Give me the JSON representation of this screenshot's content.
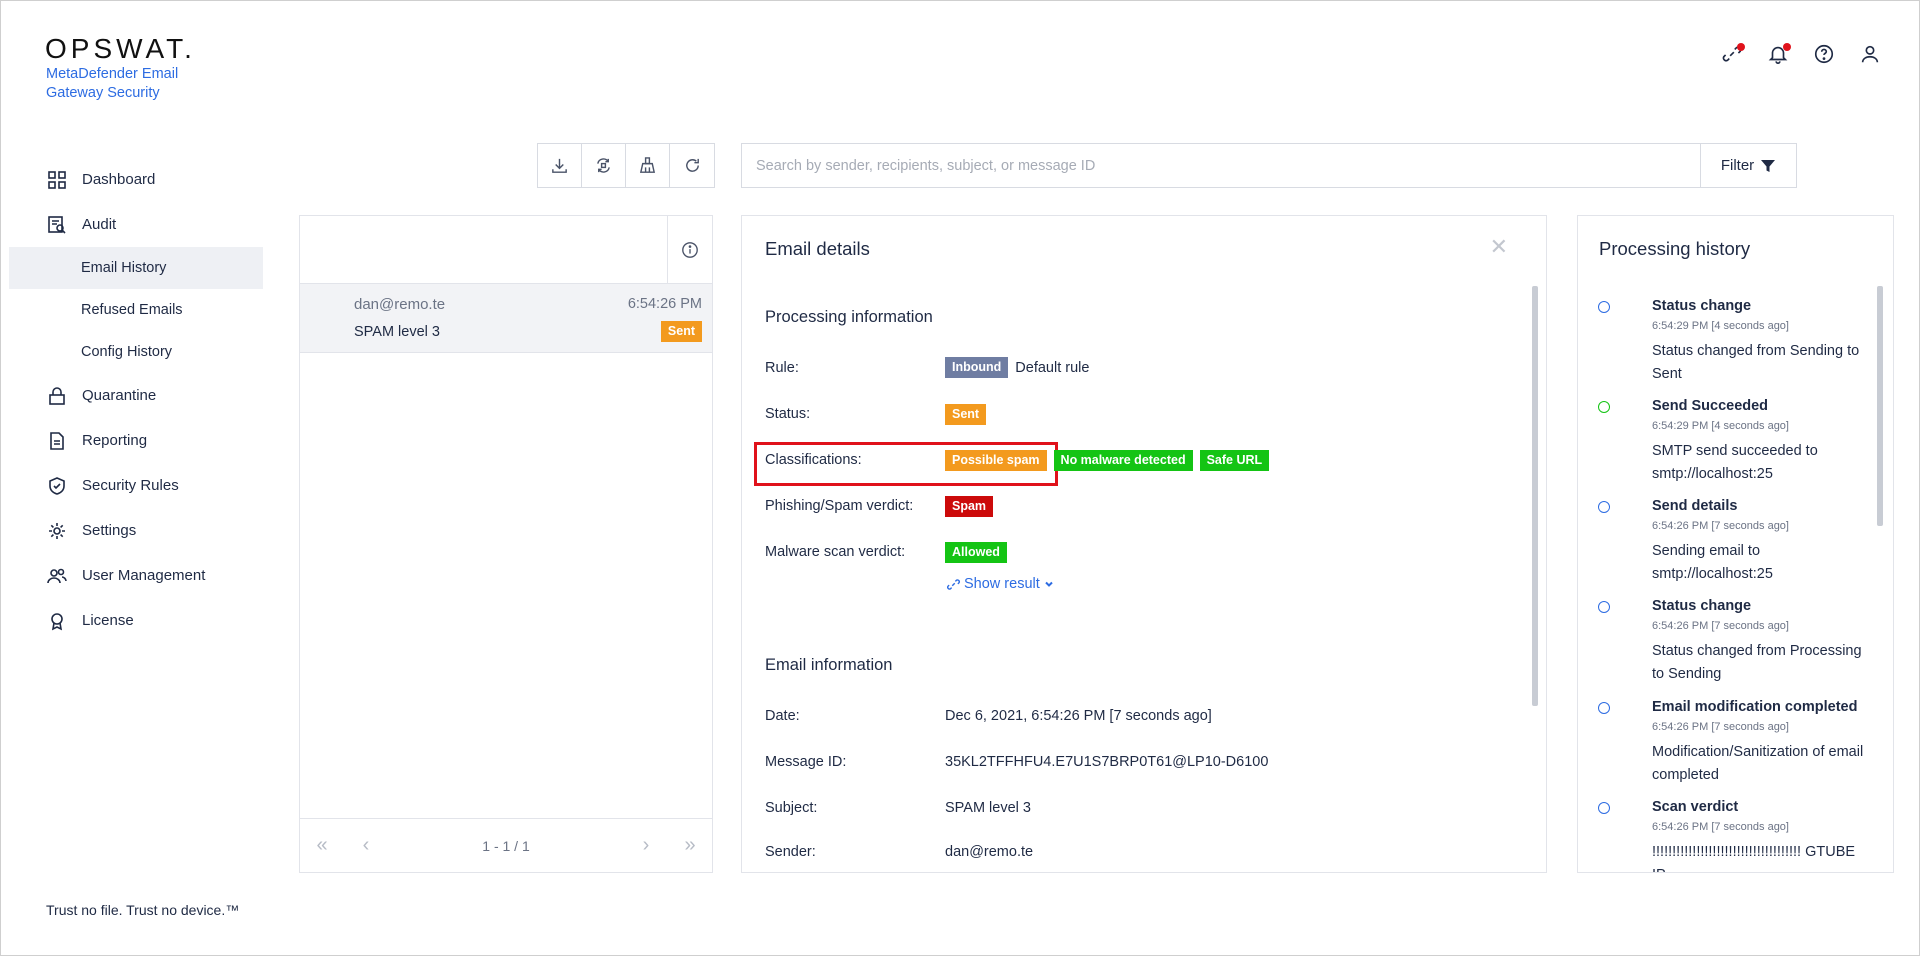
{
  "app": {
    "logo": "OPSWAT.",
    "product": "MetaDefender Email Gateway Security",
    "footer": "Trust no file. Trust no device.™"
  },
  "sidebar": {
    "items": [
      {
        "label": "Dashboard",
        "icon": "dashboard-icon"
      },
      {
        "label": "Audit",
        "icon": "audit-icon"
      },
      {
        "label": "Email History"
      },
      {
        "label": "Refused Emails"
      },
      {
        "label": "Config History"
      },
      {
        "label": "Quarantine",
        "icon": "lock-icon"
      },
      {
        "label": "Reporting",
        "icon": "report-icon"
      },
      {
        "label": "Security Rules",
        "icon": "shield-check-icon"
      },
      {
        "label": "Settings",
        "icon": "gear-icon"
      },
      {
        "label": "User Management",
        "icon": "users-icon"
      },
      {
        "label": "License",
        "icon": "award-icon"
      }
    ],
    "active": "Email History"
  },
  "search": {
    "placeholder": "Search by sender, recipients, subject, or message ID",
    "filter_label": "Filter"
  },
  "email_list": {
    "rows": [
      {
        "from": "dan@remo.te",
        "time": "6:54:26 PM",
        "subject": "SPAM level 3",
        "status": "Sent"
      }
    ],
    "pagination": "1 - 1 / 1"
  },
  "details": {
    "title": "Email details",
    "processing_title": "Processing information",
    "rule_label": "Rule:",
    "rule_badge": "Inbound",
    "rule_value": "Default rule",
    "status_label": "Status:",
    "status_badge": "Sent",
    "classifications_label": "Classifications:",
    "classifications": [
      "Possible spam",
      "No malware detected",
      "Safe URL"
    ],
    "phishing_label": "Phishing/Spam verdict:",
    "phishing_badge": "Spam",
    "malware_label": "Malware scan verdict:",
    "malware_badge": "Allowed",
    "show_result": "Show result",
    "email_info_title": "Email information",
    "date_label": "Date:",
    "date_value": "Dec 6, 2021, 6:54:26 PM [7 seconds ago]",
    "msgid_label": "Message ID:",
    "msgid_value": "35KL2TFFHFU4.E7U1S7BRP0T61@LP10-D6100",
    "subject_label": "Subject:",
    "subject_value": "SPAM level 3",
    "sender_label": "Sender:",
    "sender_value": "dan@remo.te"
  },
  "history": {
    "title": "Processing history",
    "items": [
      {
        "title": "Status change",
        "time": "6:54:29 PM [4 seconds ago]",
        "desc": "Status changed from Sending to Sent",
        "color": "blue"
      },
      {
        "title": "Send Succeeded",
        "time": "6:54:29 PM [4 seconds ago]",
        "desc": "SMTP send succeeded to smtp://localhost:25",
        "color": "green"
      },
      {
        "title": "Send details",
        "time": "6:54:26 PM [7 seconds ago]",
        "desc": "Sending email to smtp://localhost:25",
        "color": "blue"
      },
      {
        "title": "Status change",
        "time": "6:54:26 PM [7 seconds ago]",
        "desc": "Status changed from Processing to Sending",
        "color": "blue"
      },
      {
        "title": "Email modification completed",
        "time": "6:54:26 PM [7 seconds ago]",
        "desc": "Modification/Sanitization of email completed",
        "color": "blue"
      },
      {
        "title": "Scan verdict",
        "time": "6:54:26 PM [7 seconds ago]",
        "desc": "!!!!!!!!!!!!!!!!!!!!!!!!!!!!!!!!!!!!! GTUBE IP",
        "color": "blue"
      }
    ]
  },
  "colors": {
    "accent": "#2d6ce2",
    "orange": "#f39a1e",
    "green": "#14c414",
    "red": "#cc0a0a",
    "gray_badge": "#6f7da2"
  }
}
